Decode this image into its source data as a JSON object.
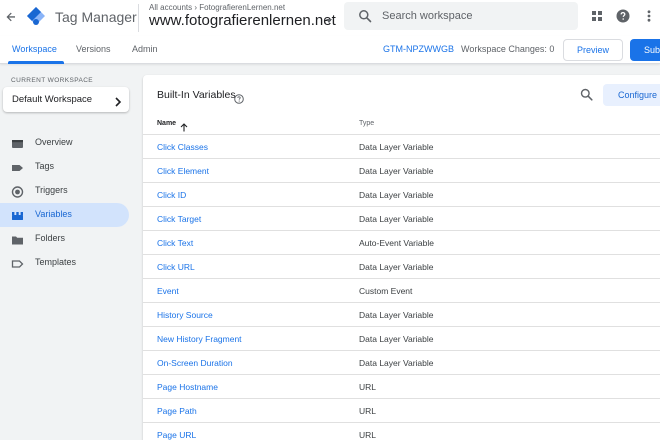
{
  "header": {
    "product_name": "Tag Manager",
    "accounts_breadcrumb": "All accounts › FotografierenLernen.net",
    "container_name": "www.fotografierenlernen.net",
    "search_placeholder": "Search workspace",
    "brand_colors": {
      "logo_dark": "#1967d2",
      "logo_light": "#8ab4f8"
    },
    "icons": [
      "back-arrow-icon",
      "gtm-logo-icon",
      "search-icon",
      "apps-grid-icon",
      "help-icon",
      "more-vert-icon"
    ]
  },
  "tabs": {
    "workspace": "Workspace",
    "versions": "Versions",
    "admin": "Admin",
    "active": "workspace",
    "container_id": "GTM-NPZWWGB",
    "workspace_changes": "Workspace Changes: 0",
    "preview_label": "Preview",
    "submit_label": "Submit"
  },
  "sidebar": {
    "current_workspace_label": "CURRENT WORKSPACE",
    "workspace_name": "Default Workspace",
    "items": [
      {
        "label": "Overview",
        "icon": "overview-icon",
        "active": false
      },
      {
        "label": "Tags",
        "icon": "tag-icon",
        "active": false
      },
      {
        "label": "Triggers",
        "icon": "trigger-icon",
        "active": false
      },
      {
        "label": "Variables",
        "icon": "variables-icon",
        "active": true
      },
      {
        "label": "Folders",
        "icon": "folder-icon",
        "active": false
      },
      {
        "label": "Templates",
        "icon": "template-icon",
        "active": false
      }
    ]
  },
  "card": {
    "title": "Built-In Variables",
    "configure_label": "Configure",
    "columns": {
      "name": "Name",
      "type": "Type"
    },
    "sort": "name-ascending",
    "rows": [
      {
        "name": "Click Classes",
        "type": "Data Layer Variable"
      },
      {
        "name": "Click Element",
        "type": "Data Layer Variable"
      },
      {
        "name": "Click ID",
        "type": "Data Layer Variable"
      },
      {
        "name": "Click Target",
        "type": "Data Layer Variable"
      },
      {
        "name": "Click Text",
        "type": "Auto-Event Variable"
      },
      {
        "name": "Click URL",
        "type": "Data Layer Variable"
      },
      {
        "name": "Event",
        "type": "Custom Event"
      },
      {
        "name": "History Source",
        "type": "Data Layer Variable"
      },
      {
        "name": "New History Fragment",
        "type": "Data Layer Variable"
      },
      {
        "name": "On-Screen Duration",
        "type": "Data Layer Variable"
      },
      {
        "name": "Page Hostname",
        "type": "URL"
      },
      {
        "name": "Page Path",
        "type": "URL"
      },
      {
        "name": "Page URL",
        "type": "URL"
      }
    ]
  },
  "colors": {
    "accent": "#1a73e8",
    "active_nav_bg": "#d2e3fc",
    "page_bg": "#f1f3f4"
  }
}
